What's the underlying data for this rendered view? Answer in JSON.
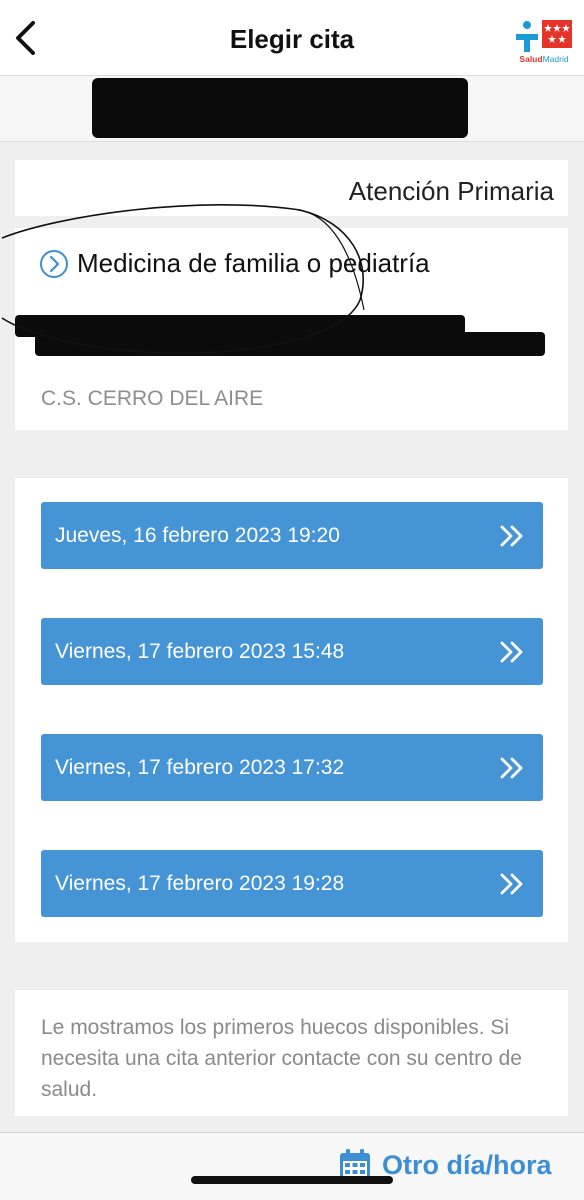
{
  "header": {
    "title": "Elegir cita",
    "logo": {
      "salud": "Salud",
      "madrid": "Madrid"
    }
  },
  "appointment": {
    "category": "Atención Primaria",
    "service": "Medicina de familia o pediatría",
    "center": "C.S. CERRO DEL AIRE"
  },
  "slots": [
    {
      "label": "Jueves, 16 febrero 2023 19:20"
    },
    {
      "label": "Viernes, 17 febrero 2023 15:48"
    },
    {
      "label": "Viernes, 17 febrero 2023 17:32"
    },
    {
      "label": "Viernes, 17 febrero 2023 19:28"
    }
  ],
  "note": "Le mostramos los primeros huecos disponibles. Si necesita una cita anterior contacte con su centro de salud.",
  "footer": {
    "other_label": "Otro día/hora"
  },
  "colors": {
    "accent": "#4595d6",
    "link": "#3c8fd4",
    "brand_red": "#e5332a",
    "brand_blue": "#1a9bd7"
  },
  "icons": [
    "back-chevron-icon",
    "salud-madrid-logo",
    "circle-chevron-right-icon",
    "double-chevron-right-icon",
    "calendar-icon"
  ]
}
